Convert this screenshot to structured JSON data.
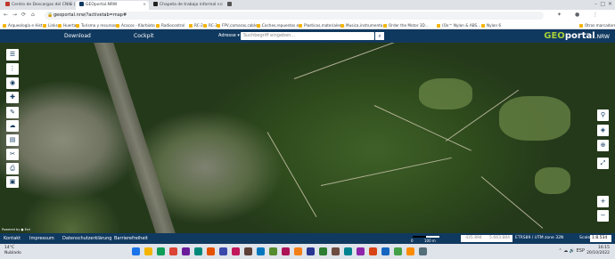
{
  "tabs": [
    {
      "label": "Centro de Descargas del CNIG (",
      "active": false,
      "color": "#c0392b"
    },
    {
      "label": "GEOportal.NRW",
      "active": true,
      "color": "#10395f"
    },
    {
      "label": "Chapeta de trabajo informal - ci",
      "active": false,
      "color": "#222222"
    },
    {
      "label": "",
      "active": false,
      "color": "#555555"
    }
  ],
  "toolbar": {
    "url": "geoportal.nrw/?activetab=map#",
    "back_icon": "←",
    "forward_icon": "→",
    "reload_icon": "⟳",
    "home_icon": "⌂"
  },
  "bookmarks": [
    "Arqueología e Hist...",
    "Links",
    "Huerta",
    "Turismo y recursos",
    "Acacos - Klarbiato",
    "Radiocontrol",
    "RC-2",
    "RC-3",
    "FPV,camaras,cables...",
    "Coches,repuestos etc",
    "Plasticos,materiales...",
    "Musica,instrumento...",
    "Order the Motor 3D...",
    "(Ox™ Nylon & ABS...",
    "Nylon 6",
    "Otros marcadores"
  ],
  "geoportal": {
    "nav": [
      "Download",
      "Cockpit"
    ],
    "search_mode": "Adresse ▾",
    "search_placeholder": "Suchbegriff eingeben...",
    "logo_geo": "GEO",
    "logo_portal": "portal",
    "logo_suffix": ".NRW",
    "powered_by": "Powered by ● Esri"
  },
  "left_tools_icons": [
    "layers-list-icon",
    "more-icon",
    "compass-icon",
    "tools-icon",
    "draw-icon",
    "cloud-download-icon",
    "print-icon",
    "info-icon",
    "share-icon",
    "print2-icon"
  ],
  "left_tools_glyphs": [
    "☰",
    "⋮",
    "◉",
    "✚",
    "✎",
    "☁",
    "▤",
    "✂",
    "⎙",
    "▣"
  ],
  "right_tools": [
    {
      "name": "scale-icon",
      "glyph": "⚲"
    },
    {
      "name": "layers-icon",
      "glyph": "◈"
    },
    {
      "name": "locate-icon",
      "glyph": "⊕"
    },
    {
      "name": "fullscreen-icon",
      "glyph": "⤢"
    },
    {
      "name": "zoom-in-icon",
      "glyph": "+"
    },
    {
      "name": "zoom-out-icon",
      "glyph": "−"
    }
  ],
  "footer": {
    "links": [
      "Kontakt",
      "Impressum",
      "Datenschutzerklärung",
      "Barrierefreiheit"
    ],
    "scale_zero": "0",
    "scale_len": "100 m",
    "coord_x": "435.894",
    "coord_y": "5.663.884",
    "crs": "ETRS89 / UTM zone 32N",
    "scale_label": "Scale:",
    "scale_value": "1:8.534"
  },
  "taskbar": {
    "weather_temp": "14°C",
    "weather_desc": "Nublado",
    "time": "16:15",
    "date": "20/10/2022",
    "app_colors": [
      "#1a73e8",
      "#f4b400",
      "#0f9d58",
      "#db4437",
      "#6a1b9a",
      "#00897b",
      "#e65100",
      "#3949ab",
      "#c2185b",
      "#5d4037",
      "#0277bd",
      "#558b2f",
      "#ad1457",
      "#f57f17",
      "#283593",
      "#2e7d32",
      "#6d4c41",
      "#00838f",
      "#8e24aa",
      "#d84315",
      "#1565c0",
      "#43a047",
      "#fb8c00",
      "#546e7a"
    ]
  }
}
